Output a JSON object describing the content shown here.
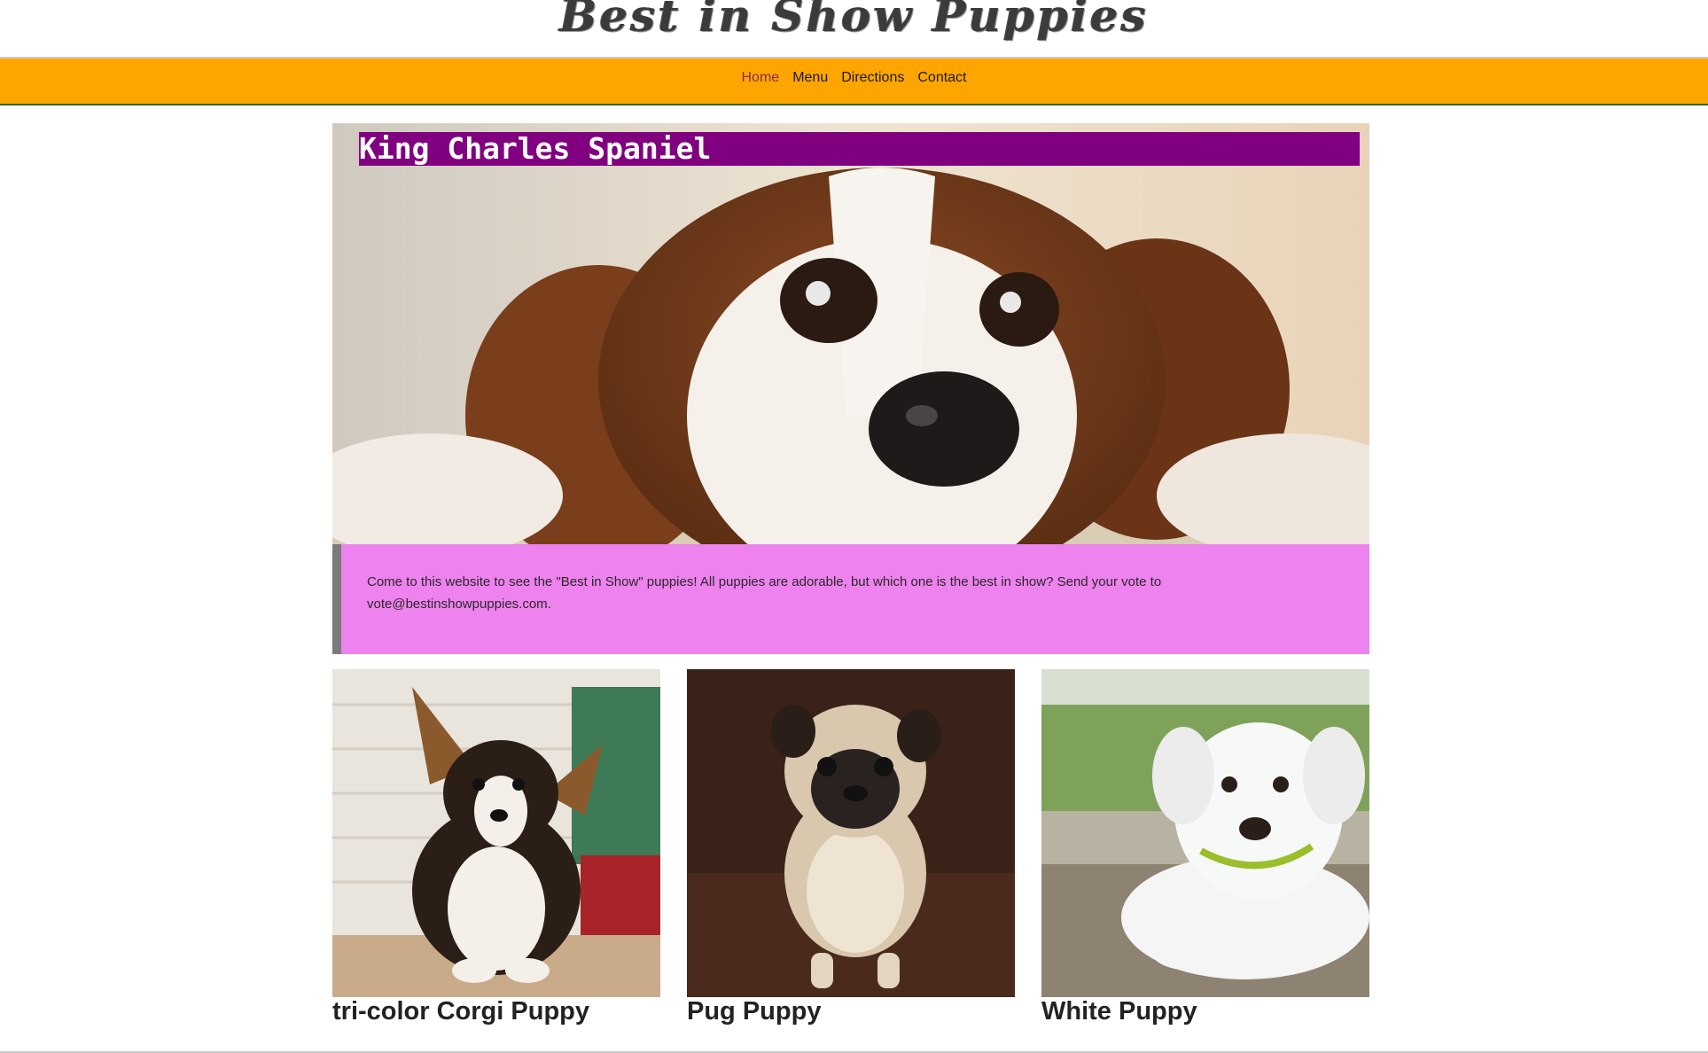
{
  "header": {
    "site_title": "Best in Show Puppies"
  },
  "nav": {
    "items": [
      {
        "label": "Home",
        "active": true
      },
      {
        "label": "Menu"
      },
      {
        "label": "Directions"
      },
      {
        "label": "Contact"
      }
    ],
    "bg_color": "#FFA500",
    "active_color": "#8a2e56"
  },
  "hero": {
    "heading": "King Charles Spaniel",
    "heading_bg": "#800080",
    "image_icon": "spaniel-photo"
  },
  "intro": {
    "text": "Come to this website to see the \"Best in Show\" puppies! All puppies are adorable, but which one is the best in show? Send your vote to vote@bestinshowpuppies.com.",
    "bg_color": "#EE82EE"
  },
  "cards": [
    {
      "title": "tri-color Corgi Puppy",
      "image_icon": "corgi-photo"
    },
    {
      "title": "Pug Puppy",
      "image_icon": "pug-photo"
    },
    {
      "title": "White Puppy",
      "image_icon": "white-puppy-photo"
    }
  ]
}
